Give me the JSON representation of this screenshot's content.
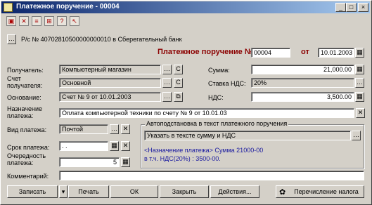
{
  "window": {
    "title": "Платежное поручение - 00004",
    "minimize": "_",
    "maximize": "□",
    "close": "×"
  },
  "account_line": "Р/с № 40702810500000000010 в Сберегательный банк",
  "document": {
    "heading": "Платежное поручение №",
    "number": "00004",
    "from_label": "от",
    "date": "10.01.2003"
  },
  "fields": {
    "recipient_label": "Получатель:",
    "recipient_value": "Компьютерный магазин",
    "account_label": "Счет получателя:",
    "account_value": "Основной",
    "basis_label": "Основание:",
    "basis_value": "Счет № 9 от 10.01.2003",
    "purpose_label": "Назначение платежа:",
    "purpose_value": "Оплата компьютерной техники по счету № 9 от 10.01.03",
    "payment_type_label": "Вид платежа:",
    "payment_type_value": "Почтой",
    "due_label": "Срок платежа:",
    "due_value": ".   .",
    "priority_label": "Очередность платежа:",
    "priority_value": "5",
    "comment_label": "Комментарий:",
    "comment_value": "",
    "sum_label": "Сумма:",
    "sum_value": "21,000.00",
    "vat_rate_label": "Ставка НДС:",
    "vat_rate_value": "20%",
    "vat_label": "НДС:",
    "vat_value": "3,500.00",
    "c_button": "С"
  },
  "auto_text": {
    "legend": "Автоподстановка в текст платежного поручения",
    "mode_value": "Указать в тексте сумму и НДС",
    "preview_line1": "<Назначение платежа> Сумма 21000-00",
    "preview_line2": "в т.ч. НДС(20%) : 3500-00."
  },
  "buttons": {
    "save": "Записать",
    "print": "Печать",
    "ok": "ОК",
    "close": "Закрыть",
    "actions": "Действия...",
    "transfer": "Перечисление налога"
  },
  "colors": {
    "title_start": "#0a246a",
    "title_end": "#a6caf0",
    "heading": "#8b0000",
    "preview_text": "#1a1aa0"
  }
}
